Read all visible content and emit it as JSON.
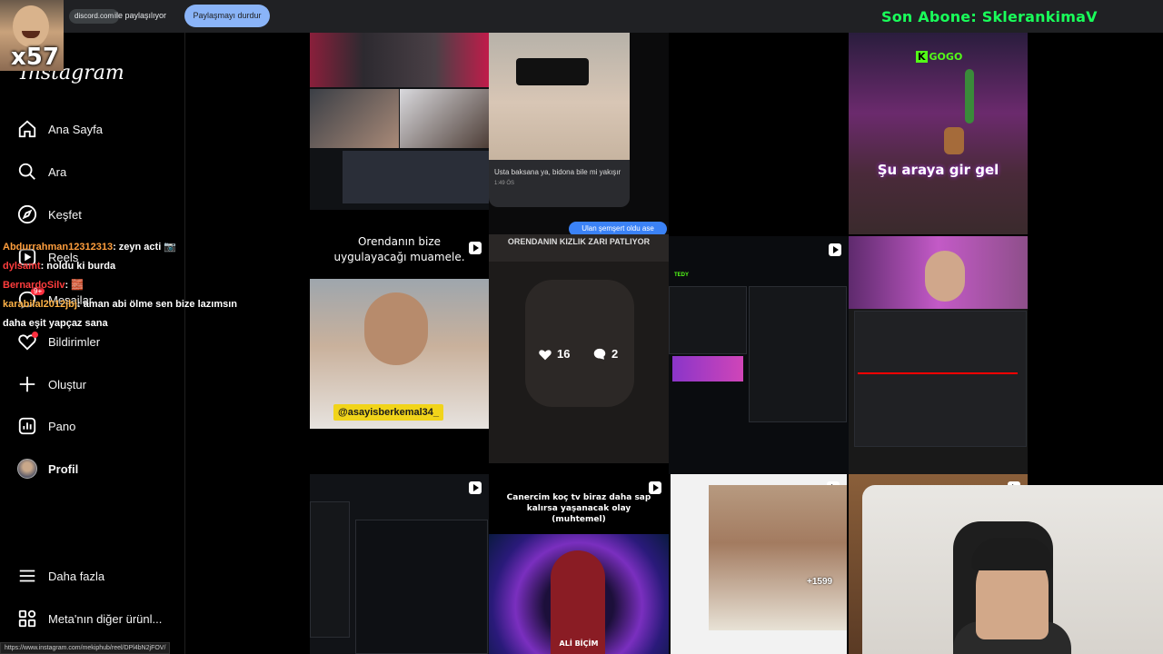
{
  "share_bar": {
    "domain": "discord.com",
    "sharing_text": "ile paylaşılıyor",
    "stop_label": "Paylaşmayı durdur"
  },
  "overlay": {
    "subscriber_banner": "Son Abone: SklerankimaV",
    "cam_tag": "x57"
  },
  "sidebar": {
    "logo": "Instagram",
    "items": [
      {
        "label": "Ana Sayfa",
        "icon": "home-icon"
      },
      {
        "label": "Ara",
        "icon": "search-icon"
      },
      {
        "label": "Keşfet",
        "icon": "compass-icon"
      },
      {
        "label": "Reels",
        "icon": "reels-icon"
      },
      {
        "label": "Mesajlar",
        "icon": "messenger-icon",
        "badge": "9+"
      },
      {
        "label": "Bildirimler",
        "icon": "heart-icon"
      },
      {
        "label": "Oluştur",
        "icon": "plus-icon"
      },
      {
        "label": "Pano",
        "icon": "dashboard-icon"
      },
      {
        "label": "Profil",
        "icon": "avatar"
      }
    ],
    "more": "Daha fazla",
    "meta": "Meta'nın diğer ürünl..."
  },
  "chat": [
    {
      "user": "Abdurrahman12312313",
      "text": ": zeyn acti 📷"
    },
    {
      "user": "dylsamt",
      "text": ": noldu ki burda"
    },
    {
      "user": "BernardoSilv",
      "text": ": 🧱"
    },
    {
      "user": "karabilal2012jbj",
      "text": ": aman abi ölme sen bize lazımsın"
    },
    {
      "user": "",
      "text": "daha eşit yapçaz sana"
    }
  ],
  "grid": {
    "tile_captions": {
      "text_bubble": "Usta baksana ya, bidona bile mi yakışır",
      "bubble_time": "1:49 ÖS",
      "green_bubble": "Ulan şemşert oldu ase",
      "gogo_text": "GOGO",
      "game_caption": "Şu araya gir gel",
      "orendan_title": "Orendanın bize uygulayacağı muamele.",
      "orendan_tag": "@asayisberkemal34_",
      "hover_banner": "ORENDANIN KIZLIK ZARI PATLIYOR",
      "likes": "16",
      "comments": "2",
      "canercim": "Canercim koç tv biraz daha sap kalırsa yaşanacak olay (muhtemel)",
      "ali_bicim": "ALİ BİÇİM",
      "kick_label": "TEDY",
      "plus_count": "+1599"
    }
  },
  "status_url": "https://www.instagram.com/mekiphub/reel/DPl4bN2jFOV/",
  "colors": {
    "background": "#000000",
    "banner_green": "#19ff5a",
    "stop_button": "#8ab4f8",
    "notification_red": "#ff3040"
  }
}
